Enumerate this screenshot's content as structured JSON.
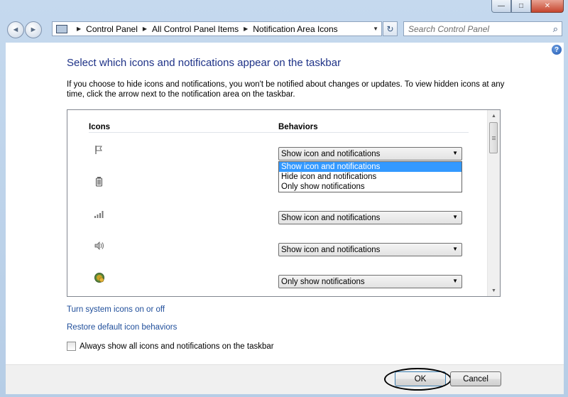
{
  "window": {
    "buttons": {
      "minimize": "—",
      "maximize": "□",
      "close": "✕"
    }
  },
  "nav": {
    "back_glyph": "◄",
    "forward_glyph": "►",
    "refresh_glyph": "↻"
  },
  "address": {
    "crumbs": [
      "Control Panel",
      "All Control Panel Items",
      "Notification Area Icons"
    ]
  },
  "search": {
    "placeholder": "Search Control Panel"
  },
  "page": {
    "title": "Select which icons and notifications appear on the taskbar",
    "description": "If you choose to hide icons and notifications, you won't be notified about changes or updates. To view hidden icons at any time, click the arrow next to the notification area on the taskbar."
  },
  "list": {
    "col_icons": "Icons",
    "col_behaviors": "Behaviors",
    "rows": [
      {
        "icon": "flag-icon",
        "behavior": "Show icon and notifications"
      },
      {
        "icon": "battery-icon",
        "behavior": ""
      },
      {
        "icon": "network-signal-icon",
        "behavior": "Show icon and notifications"
      },
      {
        "icon": "volume-icon",
        "behavior": "Show icon and notifications"
      },
      {
        "icon": "security-shield-icon",
        "behavior": "Only show notifications"
      }
    ],
    "dropdown_options": [
      "Show icon and notifications",
      "Hide icon and notifications",
      "Only show notifications"
    ],
    "dropdown_selected": "Show icon and notifications"
  },
  "links": {
    "system_icons": "Turn system icons on or off",
    "restore": "Restore default icon behaviors"
  },
  "checkbox": {
    "label": "Always show all icons and notifications on the taskbar",
    "checked": false
  },
  "footer": {
    "ok": "OK",
    "cancel": "Cancel"
  },
  "colors": {
    "accent_title": "#1e3287",
    "link": "#1e4d9a",
    "selection": "#3399ff"
  }
}
